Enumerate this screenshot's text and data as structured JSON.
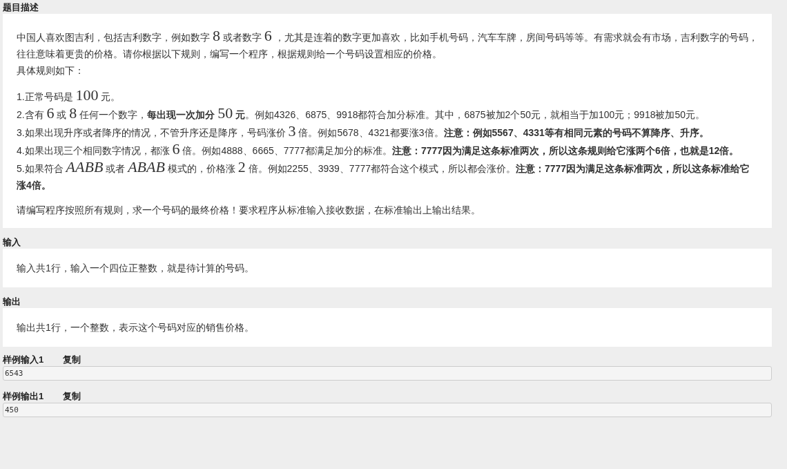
{
  "sections": [
    {
      "title": "题目描述",
      "blocks": [
        [
          {
            "segments": [
              {
                "kind": "text",
                "text": "中国人喜欢图吉利，包括吉利数字，例如数字 "
              },
              {
                "kind": "math",
                "text": "8"
              },
              {
                "kind": "text",
                "text": " 或者数字 "
              },
              {
                "kind": "math",
                "text": "6"
              },
              {
                "kind": "text",
                "text": " ，尤其是连着的数字更加喜欢，比如手机号码，汽车车牌，房间号码等等。有需求就会有市场，吉利数字的号码，往往意味着更贵的价格。请你根据以下规则，编写一个程序，根据规则给一个号码设置相应的价格。"
              }
            ]
          },
          {
            "segments": [
              {
                "kind": "text",
                "text": "具体规则如下："
              }
            ]
          }
        ],
        [
          {
            "segments": [
              {
                "kind": "text",
                "text": "1.正常号码是 "
              },
              {
                "kind": "math",
                "text": "100"
              },
              {
                "kind": "text",
                "text": " 元。"
              }
            ]
          },
          {
            "segments": [
              {
                "kind": "text",
                "text": "2.含有 "
              },
              {
                "kind": "math",
                "text": "6"
              },
              {
                "kind": "text",
                "text": " 或 "
              },
              {
                "kind": "math",
                "text": "8"
              },
              {
                "kind": "text",
                "text": " 任何一个数字，"
              },
              {
                "kind": "bold",
                "text": "每出现一次加分 "
              },
              {
                "kind": "math",
                "text": "50"
              },
              {
                "kind": "bold",
                "text": " 元"
              },
              {
                "kind": "text",
                "text": "。例如4326、6875、9918都符合加分标准。其中，6875被加2个50元，就相当于加100元；9918被加50元。"
              }
            ]
          },
          {
            "segments": [
              {
                "kind": "text",
                "text": "3.如果出现升序或者降序的情况，不管升序还是降序，号码涨价 "
              },
              {
                "kind": "math",
                "text": "3"
              },
              {
                "kind": "text",
                "text": " 倍。例如5678、4321都要涨3倍。"
              },
              {
                "kind": "bold",
                "text": "注意：例如5567、4331等有相同元素的号码不算降序、升序。"
              }
            ]
          },
          {
            "segments": [
              {
                "kind": "text",
                "text": "4.如果出现三个相同数字情况，都涨 "
              },
              {
                "kind": "math",
                "text": "6"
              },
              {
                "kind": "text",
                "text": " 倍。例如4888、6665、7777都满足加分的标准。"
              },
              {
                "kind": "bold",
                "text": "注意：7777因为满足这条标准两次，所以这条规则给它涨两个6倍，也就是12倍。"
              }
            ]
          },
          {
            "segments": [
              {
                "kind": "text",
                "text": "5.如果符合 "
              },
              {
                "kind": "var",
                "text": "AABB"
              },
              {
                "kind": "text",
                "text": " 或者 "
              },
              {
                "kind": "var",
                "text": "ABAB"
              },
              {
                "kind": "text",
                "text": " 模式的，价格涨 "
              },
              {
                "kind": "math",
                "text": "2"
              },
              {
                "kind": "text",
                "text": " 倍。例如2255、3939、7777都符合这个模式，所以都会涨价。"
              },
              {
                "kind": "bold",
                "text": "注意：7777因为满足这条标准两次，所以这条标准给它涨4倍。"
              }
            ]
          }
        ],
        [
          {
            "segments": [
              {
                "kind": "text",
                "text": "请编写程序按照所有规则，求一个号码的最终价格！要求程序从标准输入接收数据，在标准输出上输出结果。"
              }
            ]
          }
        ]
      ]
    },
    {
      "title": "输入",
      "blocks": [
        [
          {
            "segments": [
              {
                "kind": "text",
                "text": "输入共1行，输入一个四位正整数，就是待计算的号码。"
              }
            ]
          }
        ]
      ]
    },
    {
      "title": "输出",
      "blocks": [
        [
          {
            "segments": [
              {
                "kind": "text",
                "text": "输出共1行，一个整数，表示这个号码对应的销售价格。"
              }
            ]
          }
        ]
      ]
    }
  ],
  "samples": [
    {
      "title": "样例输入1",
      "copy": "复制",
      "value": "6543"
    },
    {
      "title": "样例输出1",
      "copy": "复制",
      "value": "450"
    }
  ]
}
